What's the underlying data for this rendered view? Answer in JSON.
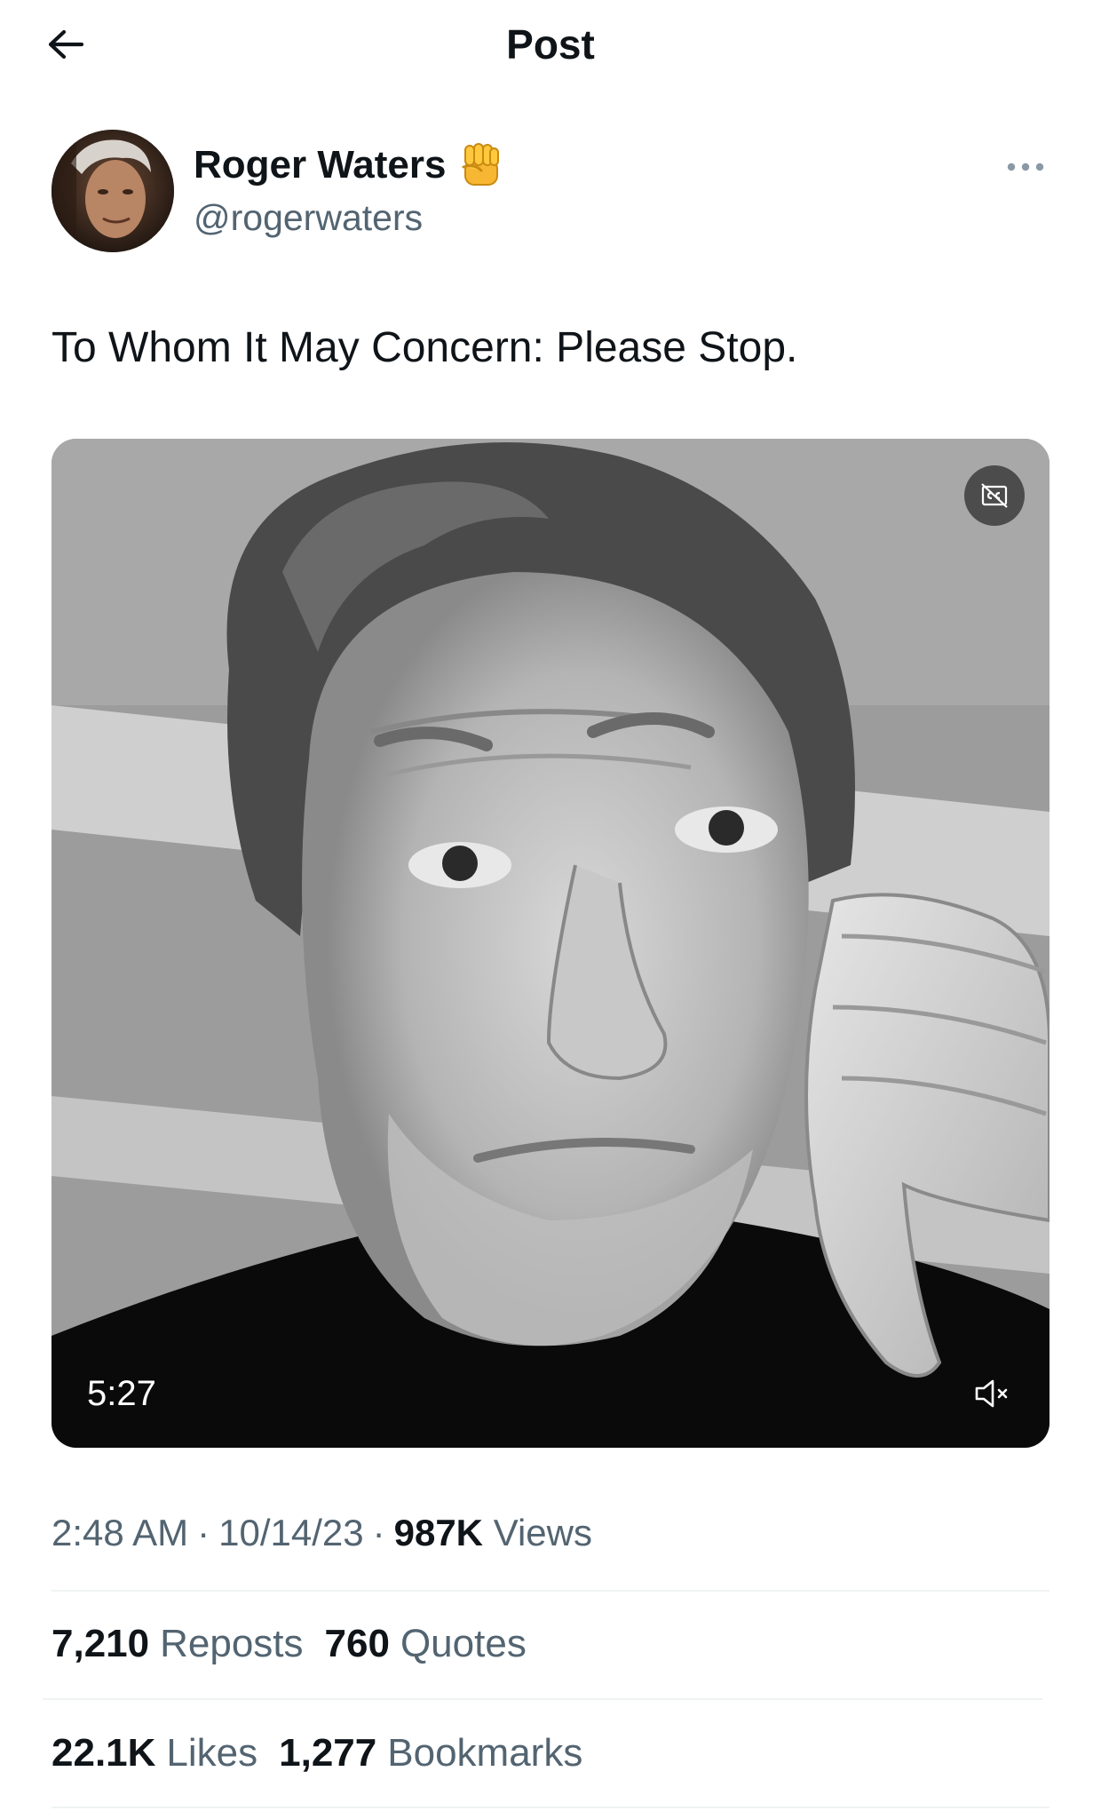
{
  "header": {
    "title": "Post",
    "back_icon": "arrow-left-icon"
  },
  "author": {
    "display_name": "Roger Waters",
    "badge_emoji": "✊",
    "handle": "@rogerwaters"
  },
  "tweet": {
    "text": "To Whom It May Concern: Please Stop."
  },
  "video": {
    "duration": "5:27",
    "caption_icon": "closed-captions-icon",
    "mute_icon": "speaker-muted-icon"
  },
  "meta": {
    "time": "2:48 AM",
    "date": "10/14/23",
    "views_count": "987K",
    "views_label": "Views",
    "separator": "·"
  },
  "stats": {
    "reposts_count": "7,210",
    "reposts_label": "Reposts",
    "quotes_count": "760",
    "quotes_label": "Quotes",
    "likes_count": "22.1K",
    "likes_label": "Likes",
    "bookmarks_count": "1,277",
    "bookmarks_label": "Bookmarks"
  },
  "colors": {
    "text": "#0f1419",
    "secondary": "#536471",
    "divider": "#eff3f4"
  }
}
